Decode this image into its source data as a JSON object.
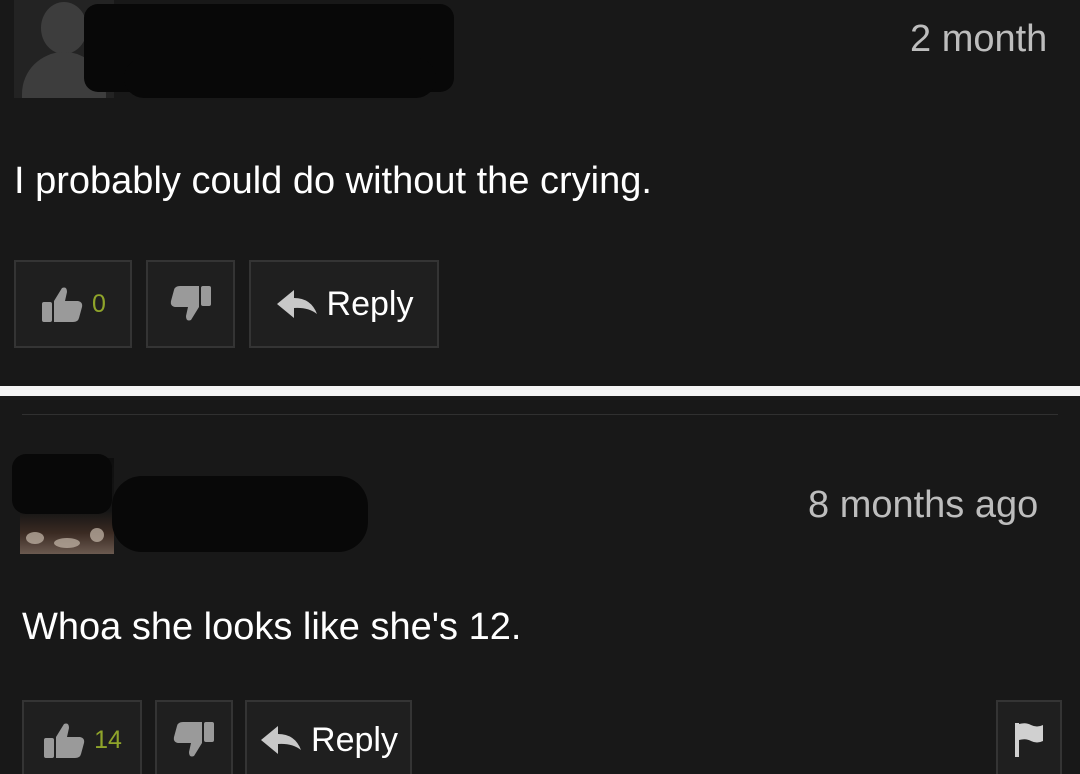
{
  "comments": [
    {
      "timestamp": "2 month",
      "text": "I probably could do without the crying.",
      "likes": "0",
      "reply_label": "Reply"
    },
    {
      "timestamp": "8 months ago",
      "text": "Whoa she looks like she's 12.",
      "likes": "14",
      "reply_label": "Reply"
    }
  ],
  "colors": {
    "background": "#181818",
    "divider": "#f4f4f4",
    "vote_count": "#8fa42a",
    "timestamp": "#bdbdbd",
    "text": "#ffffff"
  }
}
